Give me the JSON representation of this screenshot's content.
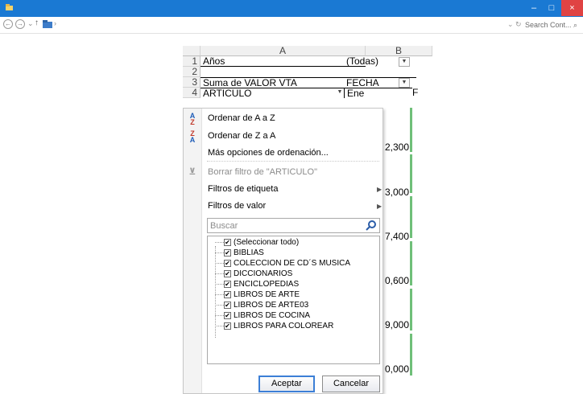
{
  "window": {
    "close_glyph": "×",
    "min_glyph": "–",
    "max_glyph": "□"
  },
  "addressbar": {
    "back": "←",
    "forward": "→",
    "history_arrow": "⌄",
    "up": "↑",
    "crumb_arrow": "›",
    "dropdown": "⌄",
    "refresh": "↻",
    "search_placeholder": "Search Cont... ⌕"
  },
  "sheet": {
    "columns": [
      "A",
      "B"
    ],
    "rows": [
      {
        "num": "1",
        "a": "Años",
        "b": "(Todas)"
      },
      {
        "num": "2",
        "a": "",
        "b": ""
      },
      {
        "num": "3",
        "a": "Suma de VALOR VTA",
        "b": "FECHA"
      },
      {
        "num": "4",
        "a": "ARTICULO",
        "b": "Ene"
      }
    ],
    "row4_extra": "F",
    "values": [
      "2,300",
      "3,000",
      "7,400",
      "0,600",
      "9,000",
      "0,000"
    ]
  },
  "menu": {
    "sort_az": "Ordenar de A a Z",
    "sort_za": "Ordenar de Z a A",
    "more_sort": "Más opciones de ordenación...",
    "clear_filter": "Borrar filtro de \"ARTICULO\"",
    "label_filters": "Filtros de etiqueta",
    "value_filters": "Filtros de valor",
    "search_placeholder": "Buscar",
    "items": [
      "(Seleccionar todo)",
      "BIBLIAS",
      "COLECCION DE CD´S MUSICA",
      "DICCIONARIOS",
      "ENCICLOPEDIAS",
      "LIBROS DE ARTE",
      "LIBROS DE ARTE03",
      "LIBROS DE COCINA",
      "LIBROS PARA COLOREAR"
    ],
    "ok": "Aceptar",
    "cancel": "Cancelar"
  },
  "colors": {
    "titlebar": "#1a79d3",
    "close": "#e04343",
    "value_bar": "#6fbf79"
  }
}
